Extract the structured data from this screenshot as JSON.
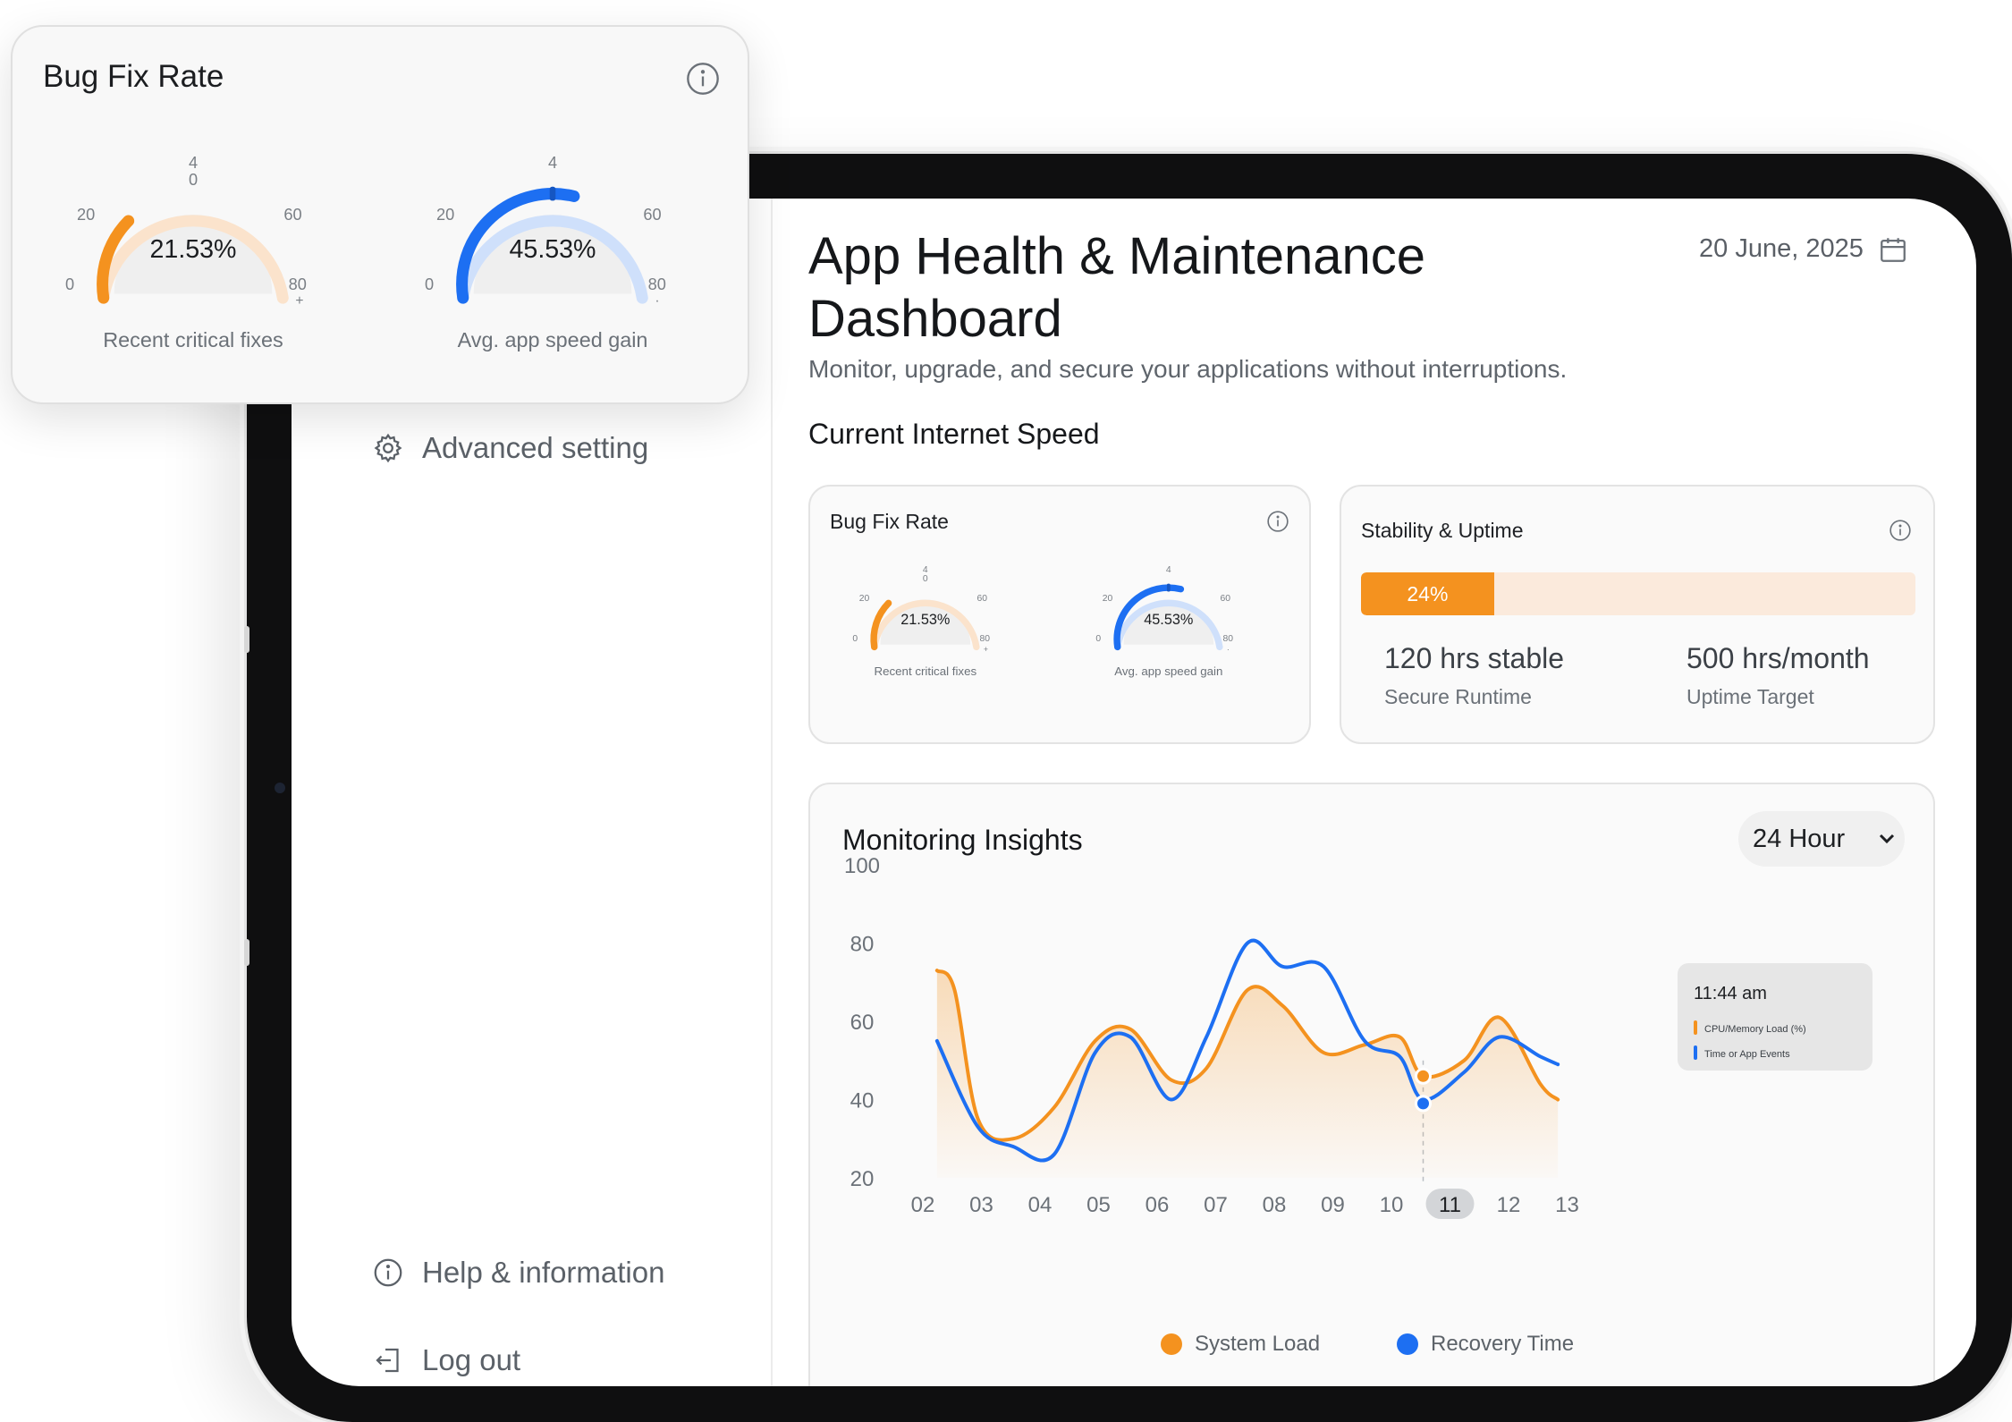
{
  "header": {
    "title_line1": "App Health & Maintenance",
    "title_line2": "Dashboard",
    "subtitle": "Monitor, upgrade, and secure your applications without interruptions.",
    "date": "20 June, 2025",
    "section_title": "Current Internet Speed"
  },
  "sidebar": {
    "items": [
      {
        "label": "Advanced setting",
        "icon": "gear-icon"
      },
      {
        "label": "Help & information",
        "icon": "info-icon"
      },
      {
        "label": "Log out",
        "icon": "logout-icon"
      }
    ]
  },
  "bug_fix": {
    "title": "Bug Fix Rate",
    "gauges": [
      {
        "value_text": "21.53%",
        "value": 21.53,
        "caption": "Recent critical fixes",
        "color": "#F4921F",
        "track": "#FBE3CC",
        "ticks": {
          "t0": "0",
          "t20": "20",
          "t4": "4",
          "t0b": "0",
          "t60": "60",
          "t80": "80",
          "plus": "+"
        }
      },
      {
        "value_text": "45.53%",
        "value": 45.53,
        "caption": "Avg. app speed gain",
        "color": "#1D6FF2",
        "track": "#CFE0FB",
        "ticks": {
          "t0": "0",
          "t20": "20",
          "t4": "4",
          "t0b": "",
          "t60": "60",
          "t80": "80",
          "plus": "·"
        }
      }
    ]
  },
  "stability": {
    "title": "Stability & Uptime",
    "progress_label": "24%",
    "progress": 0.24,
    "progress_color": "#F4921F",
    "stats": [
      {
        "value": "120 hrs stable",
        "label": "Secure Runtime"
      },
      {
        "value": "500 hrs/month",
        "label": "Uptime Target"
      }
    ]
  },
  "insights": {
    "title": "Monitoring Insights",
    "range": "24 Hour",
    "tooltip": {
      "time": "11:44 am",
      "items": [
        {
          "label": "CPU/Memory Load (%)",
          "color": "#F4921F"
        },
        {
          "label": "Time or App Events",
          "color": "#1D6FF2"
        }
      ]
    }
  },
  "chart_data": {
    "type": "line",
    "x": [
      "02",
      "03",
      "04",
      "05",
      "06",
      "07",
      "08",
      "09",
      "10",
      "11",
      "12",
      "13"
    ],
    "highlight_x": "11",
    "ylim": [
      20,
      100
    ],
    "yticks": [
      "100",
      "80",
      "60",
      "40",
      "20"
    ],
    "grid": false,
    "legend_position": "bottom",
    "series": [
      {
        "name": "System Load",
        "color": "#F4921F",
        "area": true,
        "points": [
          [
            1.7,
            73
          ],
          [
            2.0,
            68
          ],
          [
            2.4,
            35
          ],
          [
            3.0,
            30
          ],
          [
            3.7,
            38
          ],
          [
            4.4,
            55
          ],
          [
            5.0,
            58
          ],
          [
            5.7,
            45
          ],
          [
            6.3,
            48
          ],
          [
            7.0,
            68
          ],
          [
            7.6,
            64
          ],
          [
            8.3,
            52
          ],
          [
            9.0,
            54
          ],
          [
            9.6,
            56
          ],
          [
            10.0,
            46
          ],
          [
            10.7,
            50
          ],
          [
            11.3,
            61
          ],
          [
            12.0,
            44
          ],
          [
            12.3,
            40
          ]
        ],
        "marker_at": [
          10.0,
          46
        ]
      },
      {
        "name": "Recovery Time",
        "color": "#1D6FF2",
        "area": false,
        "points": [
          [
            1.7,
            55
          ],
          [
            2.4,
            33
          ],
          [
            3.0,
            28
          ],
          [
            3.7,
            26
          ],
          [
            4.4,
            52
          ],
          [
            5.0,
            56
          ],
          [
            5.7,
            40
          ],
          [
            6.3,
            56
          ],
          [
            7.0,
            80
          ],
          [
            7.6,
            74
          ],
          [
            8.3,
            74
          ],
          [
            9.0,
            55
          ],
          [
            9.6,
            51
          ],
          [
            10.0,
            40
          ],
          [
            10.7,
            47
          ],
          [
            11.3,
            56
          ],
          [
            12.0,
            51
          ],
          [
            12.3,
            49
          ]
        ],
        "marker_at": [
          10.0,
          39
        ]
      }
    ]
  },
  "colors": {
    "accent_orange": "#F4921F",
    "accent_blue": "#1D6FF2",
    "frame": "#0F0F10"
  }
}
